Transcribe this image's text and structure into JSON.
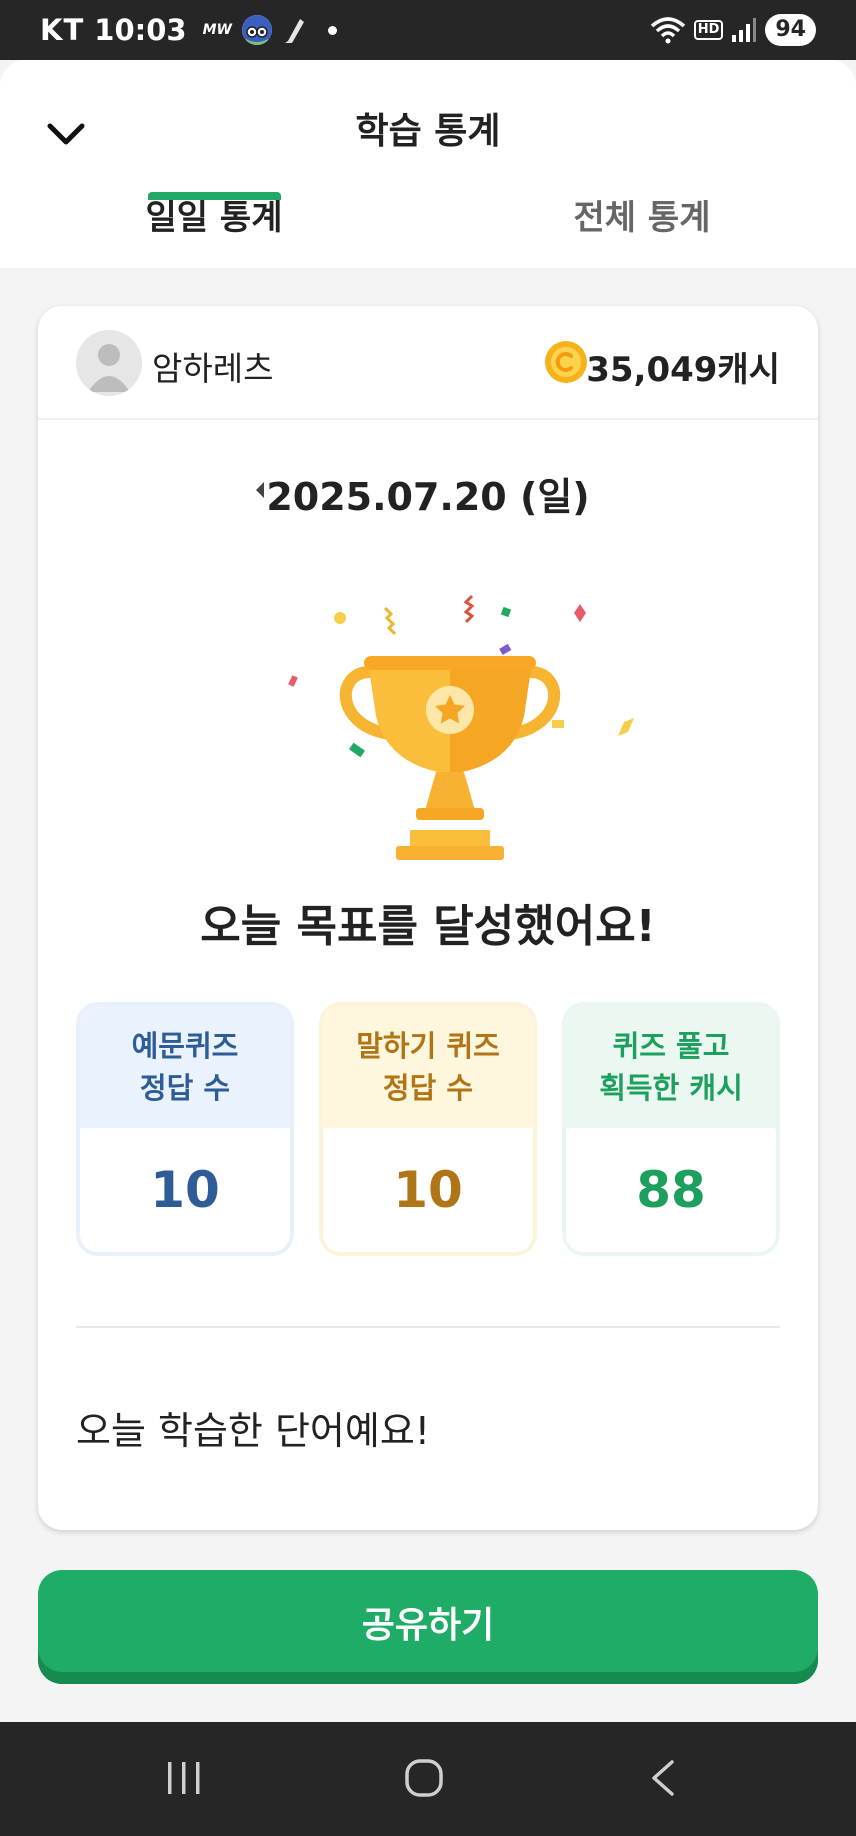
{
  "status_bar": {
    "carrier": "KT",
    "time": "10:03",
    "mw_label": "MW",
    "hd_label": "HD",
    "battery": "94"
  },
  "header": {
    "title": "학습 통계",
    "back_icon": "chevron-down-icon"
  },
  "tabs": [
    {
      "label": "일일 통계",
      "selected": true
    },
    {
      "label": "전체 통계",
      "selected": false
    }
  ],
  "user": {
    "name": "암하레츠",
    "cash": "35,049캐시",
    "coin_icon": "coin-icon"
  },
  "date": {
    "label": "2025.07.20 (일)"
  },
  "goal": {
    "title": "오늘 목표를 달성했어요!",
    "image": "trophy-icon"
  },
  "stats": [
    {
      "label_line1": "예문퀴즈",
      "label_line2": "정답 수",
      "value": "10"
    },
    {
      "label_line1": "말하기 퀴즈",
      "label_line2": "정답 수",
      "value": "10"
    },
    {
      "label_line1": "퀴즈 풀고",
      "label_line2": "획득한 캐시",
      "value": "88"
    }
  ],
  "words": {
    "title": "오늘 학습한 단어예요!"
  },
  "share_button": {
    "label": "공유하기"
  },
  "colors": {
    "accent_green": "#1fac66",
    "blue_text": "#2d5c96",
    "amber_text": "#b07516",
    "green_text": "#1d9f5e"
  }
}
